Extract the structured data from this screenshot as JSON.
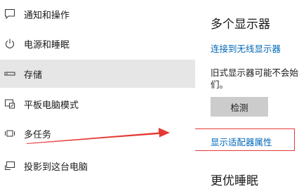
{
  "sidebar": {
    "items": [
      {
        "icon": "notification-icon",
        "label": "通知和操作"
      },
      {
        "icon": "power-icon",
        "label": "电源和睡眠"
      },
      {
        "icon": "storage-icon",
        "label": "存储"
      },
      {
        "icon": "tablet-mode-icon",
        "label": "平板电脑模式"
      },
      {
        "icon": "multitasking-icon",
        "label": "多任务"
      },
      {
        "icon": "projecting-icon",
        "label": "投影到这台电脑"
      }
    ],
    "selected_index": 2
  },
  "content": {
    "multi_display_heading": "多个显示器",
    "connect_wireless_link": "连接到无线显示器",
    "legacy_line1": "旧式显示器可能不会始",
    "legacy_line2": "们。",
    "detect_button": "检测",
    "adapter_properties_link": "显示适配器属性",
    "better_sleep_heading": "更优睡眠"
  },
  "colors": {
    "link": "#0067b8",
    "selected_bg": "#e6e6e6",
    "annotation_red": "#e53935",
    "button_bg": "#cccccc"
  }
}
